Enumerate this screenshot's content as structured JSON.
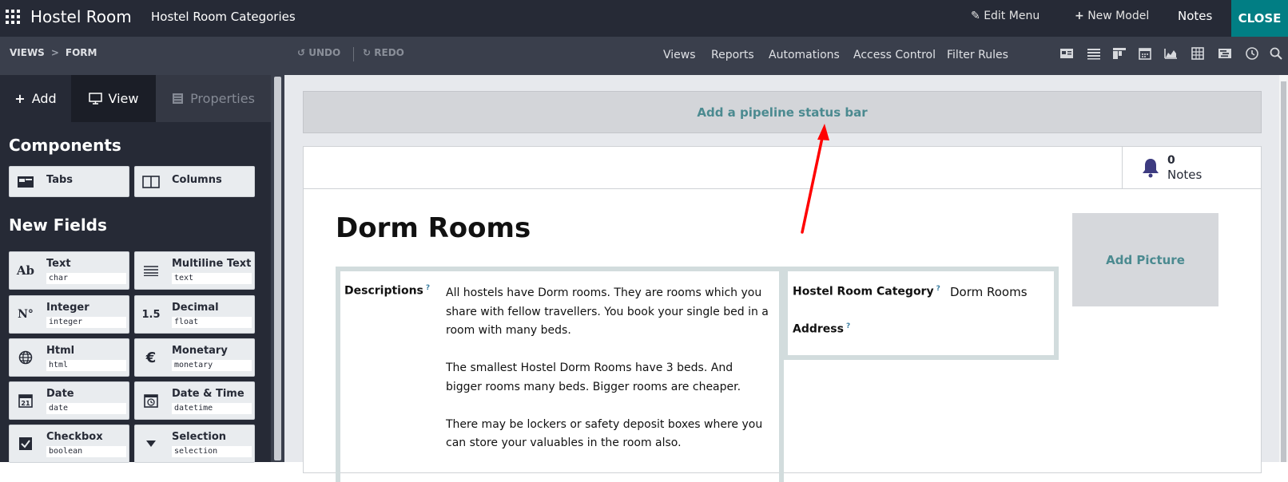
{
  "topbar": {
    "app_title": "Hostel Room",
    "model_title": "Hostel Room Categories",
    "edit_menu": "Edit Menu",
    "new_model": "New Model",
    "notes": "Notes",
    "close": "CLOSE",
    "close_color": "#017e84"
  },
  "subbar": {
    "breadcrumb": [
      "VIEWS",
      "FORM"
    ],
    "undo": "UNDO",
    "redo": "REDO",
    "nav": [
      "Views",
      "Reports",
      "Automations",
      "Access Control",
      "Filter Rules"
    ],
    "view_icons": [
      "kanban-icon",
      "list-icon",
      "dashboard-icon",
      "calendar-icon",
      "graph-icon",
      "pivot-icon",
      "gantt-icon",
      "activity-icon",
      "search-icon"
    ]
  },
  "sidebar": {
    "tabs": [
      "Add",
      "View",
      "Properties"
    ],
    "components_heading": "Components",
    "components": [
      "Tabs",
      "Columns"
    ],
    "new_fields_heading": "New Fields",
    "fields": [
      {
        "label": "Text",
        "type": "char",
        "icon": "Ab"
      },
      {
        "label": "Multiline Text",
        "type": "text",
        "icon": "lines"
      },
      {
        "label": "Integer",
        "type": "integer",
        "icon": "N°"
      },
      {
        "label": "Decimal",
        "type": "float",
        "icon": "1.5"
      },
      {
        "label": "Html",
        "type": "html",
        "icon": "globe"
      },
      {
        "label": "Monetary",
        "type": "monetary",
        "icon": "€"
      },
      {
        "label": "Date",
        "type": "date",
        "icon": "21"
      },
      {
        "label": "Date & Time",
        "type": "datetime",
        "icon": "clock"
      },
      {
        "label": "Checkbox",
        "type": "boolean",
        "icon": "check"
      },
      {
        "label": "Selection",
        "type": "selection",
        "icon": "caret"
      }
    ]
  },
  "form": {
    "pipeline_hint": "Add a pipeline status bar",
    "notes_count": "0",
    "notes_label": "Notes",
    "title": "Dorm Rooms",
    "add_picture": "Add Picture",
    "descriptions_label": "Descriptions",
    "help_mark": "?",
    "description_paragraphs": [
      "All hostels have Dorm rooms. They are rooms which you share with fellow travellers. You book your single bed in a room with many beds.",
      "The smallest Hostel Dorm Rooms have 3 beds. And bigger rooms many beds. Bigger rooms are cheaper.",
      "There may be lockers or safety deposit boxes where you can store your valuables in the room also."
    ],
    "category_label": "Hostel Room Category",
    "category_value": "Dorm Rooms",
    "address_label": "Address",
    "accent_color": "#4b8a90",
    "annotation_color": "#ff0000"
  }
}
